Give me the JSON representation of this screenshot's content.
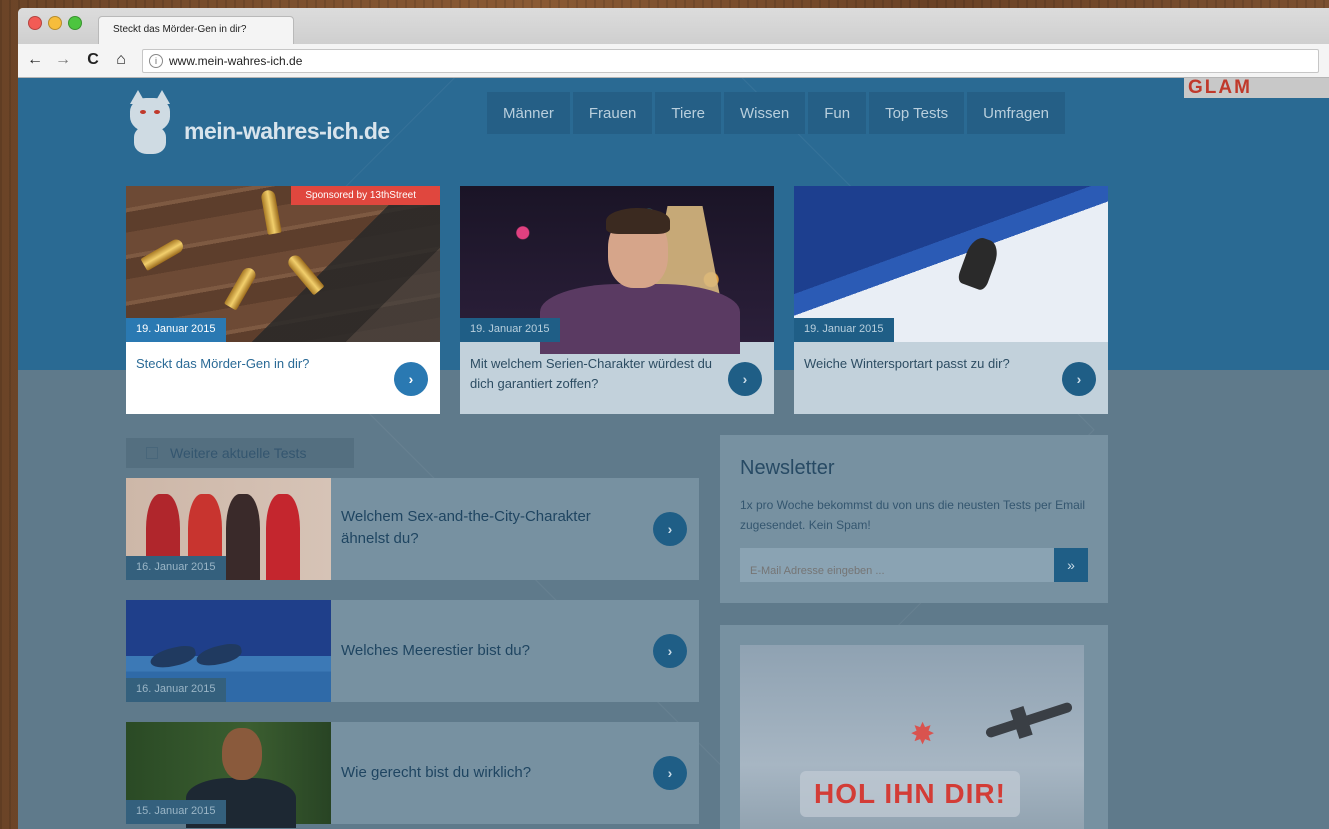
{
  "browser": {
    "tab_title": "Steckt das Mörder-Gen in dir?",
    "url": "www.mein-wahres-ich.de",
    "back_icon": "←",
    "forward_icon": "→",
    "reload_icon": "C",
    "home_icon": "⌂"
  },
  "site": {
    "logo_text": "mein-wahres-ich.de",
    "ad_brand": "GLAM",
    "nav": [
      "Männer",
      "Frauen",
      "Tiere",
      "Wissen",
      "Fun",
      "Top Tests",
      "Umfragen"
    ]
  },
  "featured": [
    {
      "date": "19. Januar 2015",
      "title": "Steckt das Mörder-Gen in dir?",
      "sponsored": "Sponsored by 13thStreet"
    },
    {
      "date": "19. Januar 2015",
      "title": "Mit welchem Serien-Charakter würdest du dich garantiert zoffen?"
    },
    {
      "date": "19. Januar 2015",
      "title": "Weiche Wintersportart passt zu dir?"
    }
  ],
  "more_tests": {
    "label": "Weitere aktuelle Tests",
    "items": [
      {
        "date": "16. Januar 2015",
        "title": "Welchem Sex-and-the-City-Charakter ähnelst du?"
      },
      {
        "date": "16. Januar 2015",
        "title": "Welches Meerestier bist du?"
      },
      {
        "date": "15. Januar 2015",
        "title": "Wie gerecht bist du wirklich?"
      }
    ]
  },
  "newsletter": {
    "title": "Newsletter",
    "text": "1x pro Woche bekommst du von uns die neusten Tests per Email zugesendet. Kein Spam!",
    "placeholder": "E-Mail Adresse eingeben ...",
    "button": "»"
  },
  "ad": {
    "slogan": "HOL IHN DIR!"
  },
  "icons": {
    "go": "›"
  }
}
